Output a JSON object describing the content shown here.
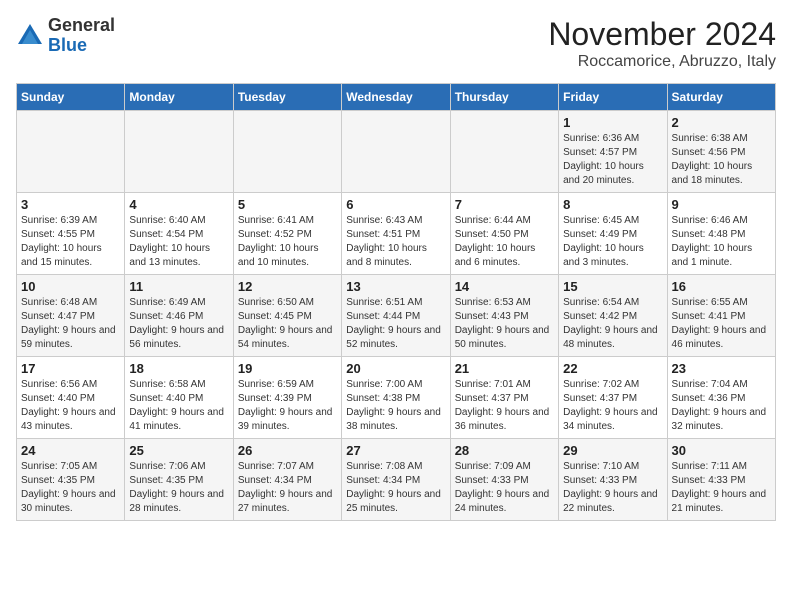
{
  "header": {
    "logo_general": "General",
    "logo_blue": "Blue",
    "month_title": "November 2024",
    "location": "Roccamorice, Abruzzo, Italy"
  },
  "days_of_week": [
    "Sunday",
    "Monday",
    "Tuesday",
    "Wednesday",
    "Thursday",
    "Friday",
    "Saturday"
  ],
  "weeks": [
    [
      {
        "day": "",
        "info": ""
      },
      {
        "day": "",
        "info": ""
      },
      {
        "day": "",
        "info": ""
      },
      {
        "day": "",
        "info": ""
      },
      {
        "day": "",
        "info": ""
      },
      {
        "day": "1",
        "info": "Sunrise: 6:36 AM\nSunset: 4:57 PM\nDaylight: 10 hours and 20 minutes."
      },
      {
        "day": "2",
        "info": "Sunrise: 6:38 AM\nSunset: 4:56 PM\nDaylight: 10 hours and 18 minutes."
      }
    ],
    [
      {
        "day": "3",
        "info": "Sunrise: 6:39 AM\nSunset: 4:55 PM\nDaylight: 10 hours and 15 minutes."
      },
      {
        "day": "4",
        "info": "Sunrise: 6:40 AM\nSunset: 4:54 PM\nDaylight: 10 hours and 13 minutes."
      },
      {
        "day": "5",
        "info": "Sunrise: 6:41 AM\nSunset: 4:52 PM\nDaylight: 10 hours and 10 minutes."
      },
      {
        "day": "6",
        "info": "Sunrise: 6:43 AM\nSunset: 4:51 PM\nDaylight: 10 hours and 8 minutes."
      },
      {
        "day": "7",
        "info": "Sunrise: 6:44 AM\nSunset: 4:50 PM\nDaylight: 10 hours and 6 minutes."
      },
      {
        "day": "8",
        "info": "Sunrise: 6:45 AM\nSunset: 4:49 PM\nDaylight: 10 hours and 3 minutes."
      },
      {
        "day": "9",
        "info": "Sunrise: 6:46 AM\nSunset: 4:48 PM\nDaylight: 10 hours and 1 minute."
      }
    ],
    [
      {
        "day": "10",
        "info": "Sunrise: 6:48 AM\nSunset: 4:47 PM\nDaylight: 9 hours and 59 minutes."
      },
      {
        "day": "11",
        "info": "Sunrise: 6:49 AM\nSunset: 4:46 PM\nDaylight: 9 hours and 56 minutes."
      },
      {
        "day": "12",
        "info": "Sunrise: 6:50 AM\nSunset: 4:45 PM\nDaylight: 9 hours and 54 minutes."
      },
      {
        "day": "13",
        "info": "Sunrise: 6:51 AM\nSunset: 4:44 PM\nDaylight: 9 hours and 52 minutes."
      },
      {
        "day": "14",
        "info": "Sunrise: 6:53 AM\nSunset: 4:43 PM\nDaylight: 9 hours and 50 minutes."
      },
      {
        "day": "15",
        "info": "Sunrise: 6:54 AM\nSunset: 4:42 PM\nDaylight: 9 hours and 48 minutes."
      },
      {
        "day": "16",
        "info": "Sunrise: 6:55 AM\nSunset: 4:41 PM\nDaylight: 9 hours and 46 minutes."
      }
    ],
    [
      {
        "day": "17",
        "info": "Sunrise: 6:56 AM\nSunset: 4:40 PM\nDaylight: 9 hours and 43 minutes."
      },
      {
        "day": "18",
        "info": "Sunrise: 6:58 AM\nSunset: 4:40 PM\nDaylight: 9 hours and 41 minutes."
      },
      {
        "day": "19",
        "info": "Sunrise: 6:59 AM\nSunset: 4:39 PM\nDaylight: 9 hours and 39 minutes."
      },
      {
        "day": "20",
        "info": "Sunrise: 7:00 AM\nSunset: 4:38 PM\nDaylight: 9 hours and 38 minutes."
      },
      {
        "day": "21",
        "info": "Sunrise: 7:01 AM\nSunset: 4:37 PM\nDaylight: 9 hours and 36 minutes."
      },
      {
        "day": "22",
        "info": "Sunrise: 7:02 AM\nSunset: 4:37 PM\nDaylight: 9 hours and 34 minutes."
      },
      {
        "day": "23",
        "info": "Sunrise: 7:04 AM\nSunset: 4:36 PM\nDaylight: 9 hours and 32 minutes."
      }
    ],
    [
      {
        "day": "24",
        "info": "Sunrise: 7:05 AM\nSunset: 4:35 PM\nDaylight: 9 hours and 30 minutes."
      },
      {
        "day": "25",
        "info": "Sunrise: 7:06 AM\nSunset: 4:35 PM\nDaylight: 9 hours and 28 minutes."
      },
      {
        "day": "26",
        "info": "Sunrise: 7:07 AM\nSunset: 4:34 PM\nDaylight: 9 hours and 27 minutes."
      },
      {
        "day": "27",
        "info": "Sunrise: 7:08 AM\nSunset: 4:34 PM\nDaylight: 9 hours and 25 minutes."
      },
      {
        "day": "28",
        "info": "Sunrise: 7:09 AM\nSunset: 4:33 PM\nDaylight: 9 hours and 24 minutes."
      },
      {
        "day": "29",
        "info": "Sunrise: 7:10 AM\nSunset: 4:33 PM\nDaylight: 9 hours and 22 minutes."
      },
      {
        "day": "30",
        "info": "Sunrise: 7:11 AM\nSunset: 4:33 PM\nDaylight: 9 hours and 21 minutes."
      }
    ]
  ]
}
